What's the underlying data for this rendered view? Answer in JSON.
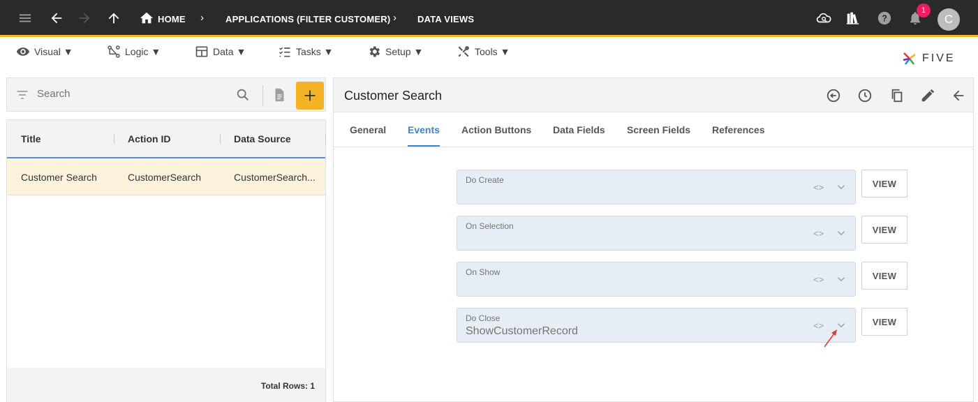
{
  "topbar": {
    "breadcrumbs": [
      "HOME",
      "APPLICATIONS (FILTER CUSTOMER)",
      "DATA VIEWS"
    ],
    "notification_count": "1",
    "avatar_initial": "C"
  },
  "menubar": {
    "items": [
      {
        "label": "Visual ▼",
        "icon": "eye-icon"
      },
      {
        "label": "Logic ▼",
        "icon": "logic-icon"
      },
      {
        "label": "Data ▼",
        "icon": "table-icon"
      },
      {
        "label": "Tasks ▼",
        "icon": "checklist-icon"
      },
      {
        "label": "Setup ▼",
        "icon": "gear-icon"
      },
      {
        "label": "Tools ▼",
        "icon": "tools-icon"
      }
    ],
    "logo_text": "FIVE"
  },
  "left": {
    "search_placeholder": "Search",
    "columns": [
      "Title",
      "Action ID",
      "Data Source"
    ],
    "rows": [
      {
        "title": "Customer Search",
        "action_id": "CustomerSearch",
        "data_source": "CustomerSearch..."
      }
    ],
    "total_rows": "Total Rows: 1"
  },
  "right": {
    "title": "Customer Search",
    "tabs": [
      "General",
      "Events",
      "Action Buttons",
      "Data Fields",
      "Screen Fields",
      "References"
    ],
    "active_tab": "Events",
    "events": [
      {
        "label": "Do Create",
        "value": "",
        "button": "VIEW"
      },
      {
        "label": "On Selection",
        "value": "",
        "button": "VIEW"
      },
      {
        "label": "On Show",
        "value": "",
        "button": "VIEW"
      },
      {
        "label": "Do Close",
        "value": "ShowCustomerRecord",
        "button": "VIEW"
      }
    ],
    "code_glyph": "<>"
  },
  "colors": {
    "topbar_bg": "#2a2a2a",
    "accent": "#f5b324",
    "active_tab": "#3d85c6",
    "selected_row": "#fdf3dc",
    "badge": "#e91e63"
  }
}
